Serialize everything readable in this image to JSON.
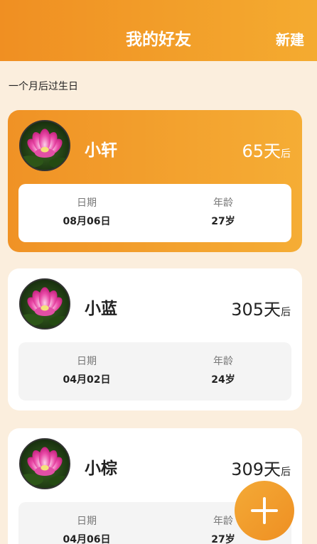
{
  "header": {
    "title": "我的好友",
    "new_label": "新建"
  },
  "section_title": "一个月后过生日",
  "friends": [
    {
      "name": "小轩",
      "days": "65天",
      "days_suffix": "后",
      "date_label": "日期",
      "date": "08月06日",
      "age_label": "年龄",
      "age": "27岁",
      "highlighted": true
    },
    {
      "name": "小蓝",
      "days": "305天",
      "days_suffix": "后",
      "date_label": "日期",
      "date": "04月02日",
      "age_label": "年龄",
      "age": "24岁",
      "highlighted": false
    },
    {
      "name": "小棕",
      "days": "309天",
      "days_suffix": "后",
      "date_label": "日期",
      "date": "04月06日",
      "age_label": "年龄",
      "age": "27岁",
      "highlighted": false
    }
  ],
  "fab_icon": "plus-icon",
  "avatar_icon": "lotus-flower-avatar",
  "colors": {
    "accent": "#f09225",
    "background": "#fbeedd"
  }
}
